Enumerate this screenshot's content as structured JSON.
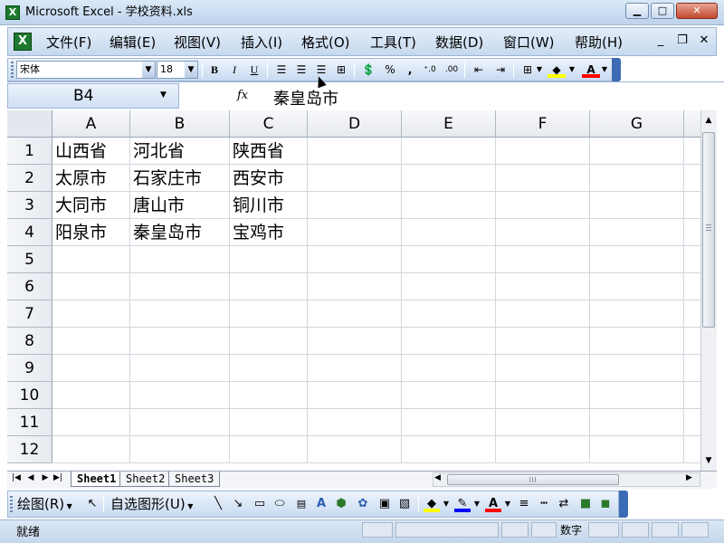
{
  "window": {
    "title": "Microsoft Excel - 学校资料.xls",
    "icon": "excel-icon"
  },
  "menu": {
    "items": [
      "文件(F)",
      "编辑(E)",
      "视图(V)",
      "插入(I)",
      "格式(O)",
      "工具(T)",
      "数据(D)",
      "窗口(W)",
      "帮助(H)"
    ]
  },
  "format_toolbar": {
    "font_name": "宋体",
    "font_size": "18"
  },
  "formula_bar": {
    "name_box": "B4",
    "fx": "fx",
    "value": "秦皇岛市"
  },
  "sheet": {
    "columns": [
      "A",
      "B",
      "C",
      "D",
      "E",
      "F",
      "G"
    ],
    "rows": [
      "1",
      "2",
      "3",
      "4",
      "5",
      "6",
      "7",
      "8",
      "9",
      "10",
      "11",
      "12"
    ],
    "cells": [
      [
        "山西省",
        "河北省",
        "陕西省"
      ],
      [
        "太原市",
        "石家庄市",
        "西安市"
      ],
      [
        "大同市",
        "唐山市",
        "铜川市"
      ],
      [
        "阳泉市",
        "秦皇岛市",
        "宝鸡市"
      ]
    ],
    "tabs": [
      "Sheet1",
      "Sheet2",
      "Sheet3"
    ]
  },
  "draw_toolbar": {
    "draw_label": "绘图(R)",
    "autoshapes_label": "自选图形(U)"
  },
  "status": {
    "ready": "就绪",
    "mode": "数字"
  },
  "colors": {
    "fill_highlight": "#ffff00",
    "font_color": "#ff0000",
    "line_color": "#0000ff"
  }
}
